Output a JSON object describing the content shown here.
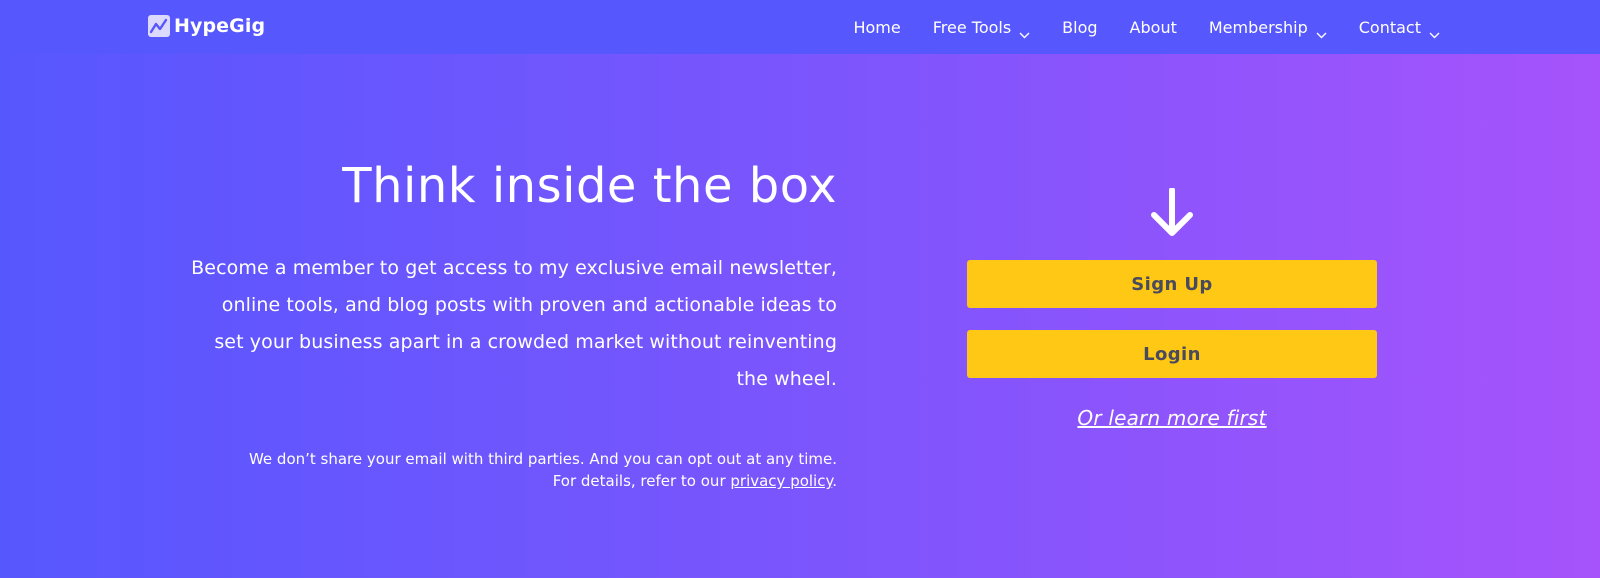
{
  "brand": {
    "name": "HypeGig",
    "logo_icon": "chart-trend-icon"
  },
  "nav": {
    "items": [
      {
        "label": "Home",
        "dropdown": false
      },
      {
        "label": "Free Tools",
        "dropdown": true
      },
      {
        "label": "Blog",
        "dropdown": false
      },
      {
        "label": "About",
        "dropdown": false
      },
      {
        "label": "Membership",
        "dropdown": true
      },
      {
        "label": "Contact",
        "dropdown": true
      }
    ]
  },
  "hero": {
    "title": "Think inside the box",
    "description": "Become a member to get access to my exclusive email newsletter, online tools, and blog posts with proven and actionable ideas to set your business apart in a crowded market without reinventing the wheel.",
    "note_prefix": "We don’t share your email with third parties. And you can opt out at any time. For details, refer to our ",
    "note_link": "privacy policy",
    "note_suffix": "."
  },
  "cta": {
    "arrow_icon": "arrow-down-icon",
    "signup_label": "Sign Up",
    "login_label": "Login",
    "learn_more_label": "Or learn more first"
  },
  "colors": {
    "nav_bg": "#5757fe",
    "gradient_start": "#5757fe",
    "gradient_end": "#a653fb",
    "button_bg": "#fec814",
    "button_text": "#4a4a5e",
    "text": "#ffffff"
  }
}
